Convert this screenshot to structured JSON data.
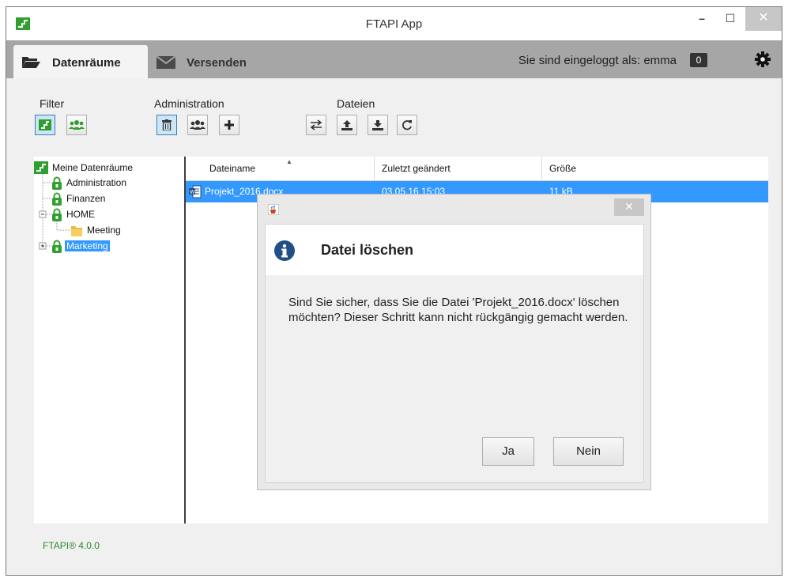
{
  "window": {
    "title": "FTAPI App",
    "min_glyph": "–",
    "max_glyph": "☐",
    "close_glyph": "✕"
  },
  "tabs": [
    {
      "label": "Datenräume",
      "icon": "folder-open-icon",
      "active": true
    },
    {
      "label": "Versenden",
      "icon": "envelope-icon",
      "active": false
    }
  ],
  "header": {
    "login_text": "Sie sind eingeloggt als: emma",
    "notification_count": "0",
    "settings_icon": "gear-icon"
  },
  "toolbar": {
    "filter_label": "Filter",
    "administration_label": "Administration",
    "files_label": "Dateien"
  },
  "tree": {
    "root": "Meine Datenräume",
    "items": [
      "Administration",
      "Finanzen",
      "HOME",
      "Meeting",
      "Marketing"
    ],
    "selected": "Marketing"
  },
  "filelist": {
    "columns": [
      "Dateiname",
      "Zuletzt geändert",
      "Größe"
    ],
    "rows": [
      {
        "name": "Projekt_2016.docx",
        "modified": "03.05.16 15:03",
        "size": "11 kB"
      }
    ]
  },
  "status": {
    "version": "FTAPI® 4.0.0"
  },
  "dialog": {
    "title": "Datei löschen",
    "close_glyph": "✕",
    "message": "Sind Sie sicher, dass Sie die Datei 'Projekt_2016.docx' löschen möchten? Dieser Schritt kann nicht rückgängig gemacht werden.",
    "yes_label": "Ja",
    "no_label": "Nein"
  },
  "colors": {
    "brand_green": "#2fa02f",
    "selection_blue": "#3399ff",
    "tab_bar_gray": "#a6a6a6",
    "info_blue": "#1e4f86"
  }
}
